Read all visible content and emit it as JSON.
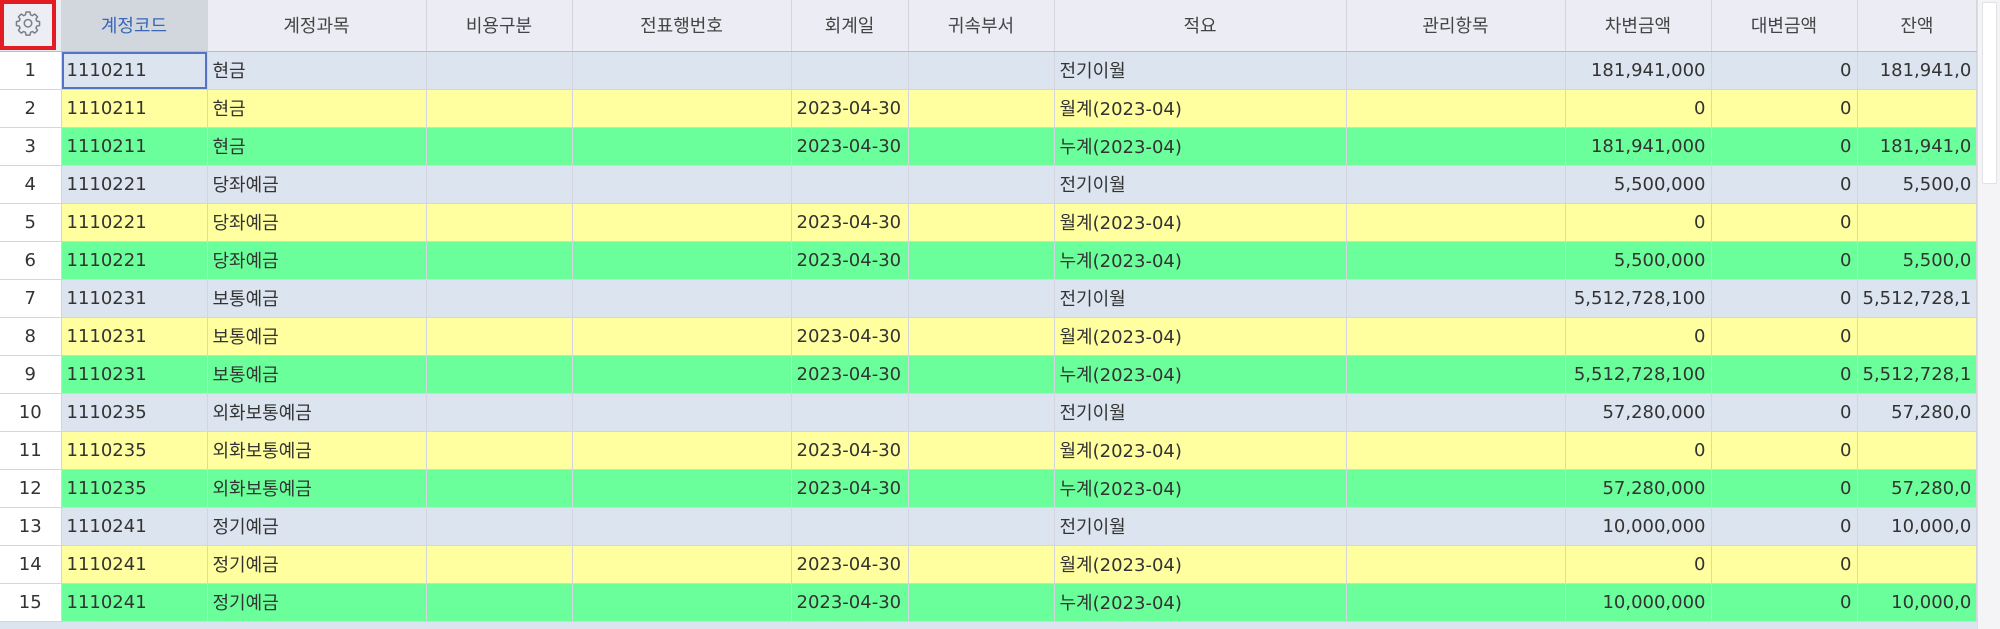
{
  "grid": {
    "columns": [
      "계정코드",
      "계정과목",
      "비용구분",
      "전표행번호",
      "회계일",
      "귀속부서",
      "적요",
      "관리항목",
      "차변금액",
      "대변금액",
      "잔액"
    ],
    "rows": [
      {
        "no": "1",
        "code": "1110211",
        "account": "현금",
        "expense_type": "",
        "slip_line": "",
        "date": "",
        "dept": "",
        "summary": "전기이월",
        "mgmt": "",
        "debit": "181,941,000",
        "credit": "0",
        "balance": "181,941,0",
        "kind": "blue"
      },
      {
        "no": "2",
        "code": "1110211",
        "account": "현금",
        "expense_type": "",
        "slip_line": "",
        "date": "2023-04-30",
        "dept": "",
        "summary": "월계(2023-04)",
        "mgmt": "",
        "debit": "0",
        "credit": "0",
        "balance": "",
        "kind": "yellow"
      },
      {
        "no": "3",
        "code": "1110211",
        "account": "현금",
        "expense_type": "",
        "slip_line": "",
        "date": "2023-04-30",
        "dept": "",
        "summary": "누계(2023-04)",
        "mgmt": "",
        "debit": "181,941,000",
        "credit": "0",
        "balance": "181,941,0",
        "kind": "green"
      },
      {
        "no": "4",
        "code": "1110221",
        "account": "당좌예금",
        "expense_type": "",
        "slip_line": "",
        "date": "",
        "dept": "",
        "summary": "전기이월",
        "mgmt": "",
        "debit": "5,500,000",
        "credit": "0",
        "balance": "5,500,0",
        "kind": "blue"
      },
      {
        "no": "5",
        "code": "1110221",
        "account": "당좌예금",
        "expense_type": "",
        "slip_line": "",
        "date": "2023-04-30",
        "dept": "",
        "summary": "월계(2023-04)",
        "mgmt": "",
        "debit": "0",
        "credit": "0",
        "balance": "",
        "kind": "yellow"
      },
      {
        "no": "6",
        "code": "1110221",
        "account": "당좌예금",
        "expense_type": "",
        "slip_line": "",
        "date": "2023-04-30",
        "dept": "",
        "summary": "누계(2023-04)",
        "mgmt": "",
        "debit": "5,500,000",
        "credit": "0",
        "balance": "5,500,0",
        "kind": "green"
      },
      {
        "no": "7",
        "code": "1110231",
        "account": "보통예금",
        "expense_type": "",
        "slip_line": "",
        "date": "",
        "dept": "",
        "summary": "전기이월",
        "mgmt": "",
        "debit": "5,512,728,100",
        "credit": "0",
        "balance": "5,512,728,1",
        "kind": "blue"
      },
      {
        "no": "8",
        "code": "1110231",
        "account": "보통예금",
        "expense_type": "",
        "slip_line": "",
        "date": "2023-04-30",
        "dept": "",
        "summary": "월계(2023-04)",
        "mgmt": "",
        "debit": "0",
        "credit": "0",
        "balance": "",
        "kind": "yellow"
      },
      {
        "no": "9",
        "code": "1110231",
        "account": "보통예금",
        "expense_type": "",
        "slip_line": "",
        "date": "2023-04-30",
        "dept": "",
        "summary": "누계(2023-04)",
        "mgmt": "",
        "debit": "5,512,728,100",
        "credit": "0",
        "balance": "5,512,728,1",
        "kind": "green"
      },
      {
        "no": "10",
        "code": "1110235",
        "account": "외화보통예금",
        "expense_type": "",
        "slip_line": "",
        "date": "",
        "dept": "",
        "summary": "전기이월",
        "mgmt": "",
        "debit": "57,280,000",
        "credit": "0",
        "balance": "57,280,0",
        "kind": "blue"
      },
      {
        "no": "11",
        "code": "1110235",
        "account": "외화보통예금",
        "expense_type": "",
        "slip_line": "",
        "date": "2023-04-30",
        "dept": "",
        "summary": "월계(2023-04)",
        "mgmt": "",
        "debit": "0",
        "credit": "0",
        "balance": "",
        "kind": "yellow"
      },
      {
        "no": "12",
        "code": "1110235",
        "account": "외화보통예금",
        "expense_type": "",
        "slip_line": "",
        "date": "2023-04-30",
        "dept": "",
        "summary": "누계(2023-04)",
        "mgmt": "",
        "debit": "57,280,000",
        "credit": "0",
        "balance": "57,280,0",
        "kind": "green"
      },
      {
        "no": "13",
        "code": "1110241",
        "account": "정기예금",
        "expense_type": "",
        "slip_line": "",
        "date": "",
        "dept": "",
        "summary": "전기이월",
        "mgmt": "",
        "debit": "10,000,000",
        "credit": "0",
        "balance": "10,000,0",
        "kind": "blue"
      },
      {
        "no": "14",
        "code": "1110241",
        "account": "정기예금",
        "expense_type": "",
        "slip_line": "",
        "date": "2023-04-30",
        "dept": "",
        "summary": "월계(2023-04)",
        "mgmt": "",
        "debit": "0",
        "credit": "0",
        "balance": "",
        "kind": "yellow"
      },
      {
        "no": "15",
        "code": "1110241",
        "account": "정기예금",
        "expense_type": "",
        "slip_line": "",
        "date": "2023-04-30",
        "dept": "",
        "summary": "누계(2023-04)",
        "mgmt": "",
        "debit": "10,000,000",
        "credit": "0",
        "balance": "10,000,0",
        "kind": "green"
      }
    ]
  },
  "toolbar": {
    "settings_icon": "gear-icon"
  },
  "colors": {
    "row_carryover": "#dce4f0",
    "row_monthly": "#ffffa0",
    "row_cumulative": "#6bff9b",
    "header_bg": "#ecedf4",
    "sorted_header_text": "#3a66b8",
    "highlight_border": "#e31c24"
  }
}
